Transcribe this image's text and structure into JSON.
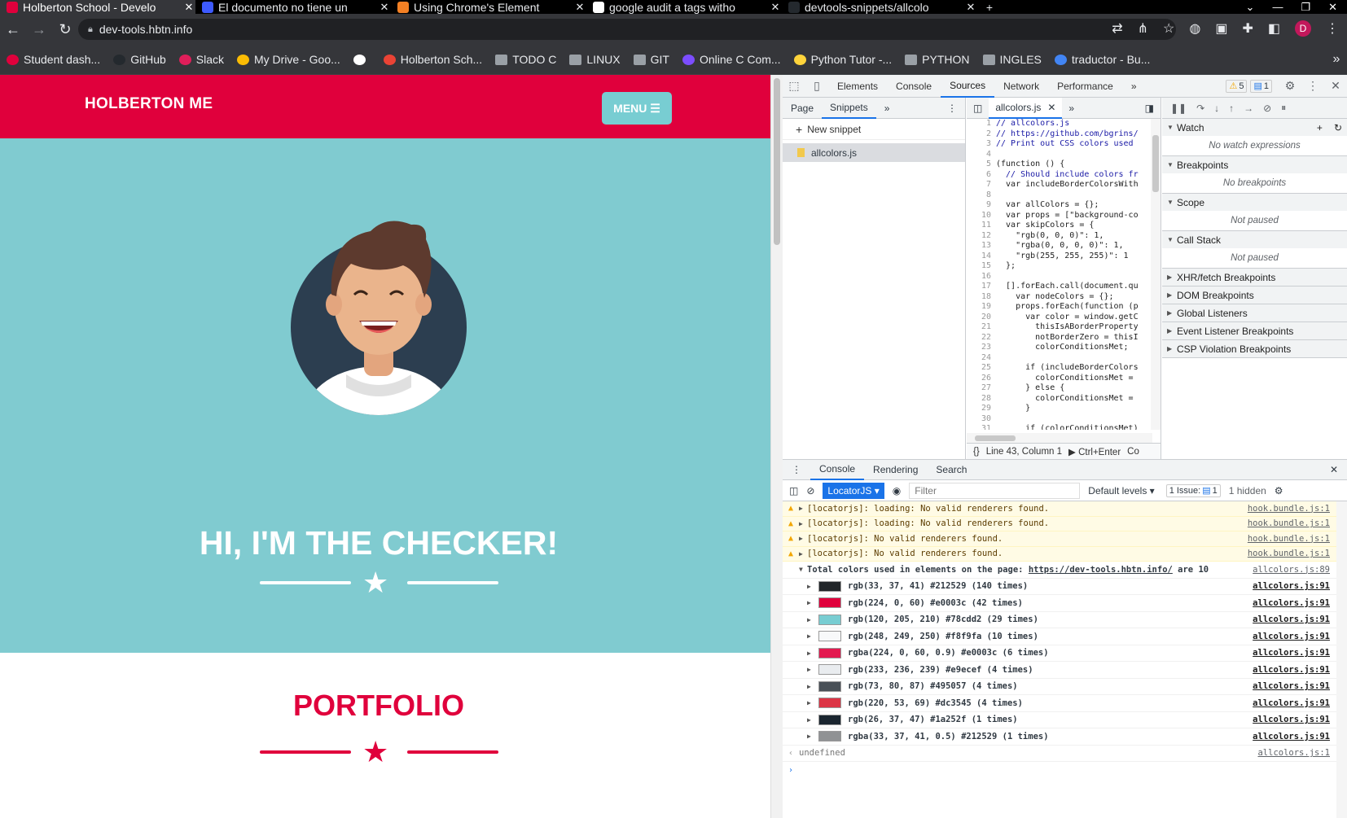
{
  "browser": {
    "tabs": [
      {
        "title": "Holberton School - Develo",
        "favicon_color": "#e0003c",
        "active": true
      },
      {
        "title": "El documento no tiene un",
        "favicon_color": "#3d5afe"
      },
      {
        "title": "Using Chrome's Element",
        "favicon_color": "#f48024"
      },
      {
        "title": "google audit a tags witho",
        "favicon_color": "#ffffff"
      },
      {
        "title": "devtools-snippets/allcolo",
        "favicon_color": "#24292e"
      }
    ],
    "tab_close": "✕",
    "new_tab": "+",
    "url": "dev-tools.hbtn.info",
    "profile_initial": "D",
    "bookmarks": [
      {
        "label": "Student dash...",
        "icon": "holberton-icon",
        "color": "#e0003c"
      },
      {
        "label": "GitHub",
        "icon": "github-icon",
        "color": "#24292e"
      },
      {
        "label": "Slack",
        "icon": "slack-icon",
        "color": "#e01e5a"
      },
      {
        "label": "My Drive - Goo...",
        "icon": "drive-icon",
        "color": "#fbbc04"
      },
      {
        "label": "",
        "icon": "globe-icon",
        "color": "#ffffff"
      },
      {
        "label": "Holberton Sch...",
        "icon": "gmail-icon",
        "color": "#ea4335"
      },
      {
        "label": "TODO C",
        "icon": "folder-icon",
        "color": "#9aa0a6"
      },
      {
        "label": "LINUX",
        "icon": "folder-icon",
        "color": "#9aa0a6"
      },
      {
        "label": "GIT",
        "icon": "folder-icon",
        "color": "#9aa0a6"
      },
      {
        "label": "Online C Com...",
        "icon": "compiler-icon",
        "color": "#7c4dff"
      },
      {
        "label": "Python Tutor -...",
        "icon": "python-icon",
        "color": "#ffd43b"
      },
      {
        "label": "PYTHON",
        "icon": "folder-icon",
        "color": "#9aa0a6"
      },
      {
        "label": "INGLES",
        "icon": "folder-icon",
        "color": "#9aa0a6"
      },
      {
        "label": "traductor - Bu...",
        "icon": "google-icon",
        "color": "#4285f4"
      }
    ],
    "more_bookmarks": "»"
  },
  "site": {
    "brand": "HOLBERTON ME",
    "menu_label": "MENU ☰",
    "hero_title": "HI, I'M THE CHECKER!",
    "portfolio_title": "PORTFOLIO",
    "colors": {
      "primary": "#e0003c",
      "secondary": "#78cdd2",
      "hero_bg": "#80cbd0"
    }
  },
  "devtools": {
    "tabs": [
      "Elements",
      "Console",
      "Sources",
      "Network",
      "Performance"
    ],
    "active_tab": "Sources",
    "more": "»",
    "warn_count": "5",
    "info_count": "1",
    "navigator_tabs": [
      "Page",
      "Snippets"
    ],
    "new_snippet": "New snippet",
    "snippet_file": "allcolors.js",
    "editor_file": "allcolors.js",
    "code_lines": [
      "// allcolors.js",
      "// https://github.com/bgrins/",
      "// Print out CSS colors used",
      "",
      "(function () {",
      "  // Should include colors fr",
      "  var includeBorderColorsWith",
      "",
      "  var allColors = {};",
      "  var props = [\"background-co",
      "  var skipColors = {",
      "    \"rgb(0, 0, 0)\": 1,",
      "    \"rgba(0, 0, 0, 0)\": 1,",
      "    \"rgb(255, 255, 255)\": 1",
      "  };",
      "",
      "  [].forEach.call(document.qu",
      "    var nodeColors = {};",
      "    props.forEach(function (p",
      "      var color = window.getC",
      "        thisIsABorderProperty",
      "        notBorderZero = thisI",
      "        colorConditionsMet;",
      "",
      "      if (includeBorderColors",
      "        colorConditionsMet =",
      "      } else {",
      "        colorConditionsMet =",
      "      }",
      "",
      "      if (colorConditionsMet)"
    ],
    "status_braces": "{}",
    "status_position": "Line 43, Column 1",
    "status_run": "▶ Ctrl+Enter",
    "status_tail": "Co",
    "side_sections": [
      {
        "title": "Watch",
        "open": true,
        "body": "No watch expressions"
      },
      {
        "title": "Breakpoints",
        "open": true,
        "body": "No breakpoints"
      },
      {
        "title": "Scope",
        "open": true,
        "body": "Not paused"
      },
      {
        "title": "Call Stack",
        "open": true,
        "body": "Not paused"
      },
      {
        "title": "XHR/fetch Breakpoints",
        "open": false
      },
      {
        "title": "DOM Breakpoints",
        "open": false
      },
      {
        "title": "Global Listeners",
        "open": false
      },
      {
        "title": "Event Listener Breakpoints",
        "open": false
      },
      {
        "title": "CSP Violation Breakpoints",
        "open": false
      }
    ],
    "drawer_tabs": [
      "Console",
      "Rendering",
      "Search"
    ],
    "context": "LocatorJS ▾",
    "filter_placeholder": "Filter",
    "levels": "Default levels ▾",
    "issues": "1 Issue:",
    "issues_count": "1",
    "hidden": "1 hidden",
    "console_warnings": [
      {
        "text": "[locatorjs]: loading: No valid renderers found.",
        "src": "hook.bundle.js:1"
      },
      {
        "text": "[locatorjs]: loading: No valid renderers found.",
        "src": "hook.bundle.js:1"
      },
      {
        "text": "[locatorjs]: No valid renderers found.",
        "src": "hook.bundle.js:1"
      },
      {
        "text": "[locatorjs]: No valid renderers found.",
        "src": "hook.bundle.js:1"
      }
    ],
    "total_line": {
      "prefix": "Total colors used in elements on the page: ",
      "link": "https://dev-tools.hbtn.info/",
      "suffix": " are 10",
      "src": "allcolors.js:89"
    },
    "color_rows": [
      {
        "text": "rgb(33, 37, 41) #212529 (140 times)",
        "swatch": "#212529",
        "src": "allcolors.js:91"
      },
      {
        "text": "rgb(224, 0, 60) #e0003c (42 times)",
        "swatch": "#e0003c",
        "src": "allcolors.js:91"
      },
      {
        "text": "rgb(120, 205, 210) #78cdd2 (29 times)",
        "swatch": "#78cdd2",
        "src": "allcolors.js:91"
      },
      {
        "text": "rgb(248, 249, 250) #f8f9fa (10 times)",
        "swatch": "#f8f9fa",
        "src": "allcolors.js:91"
      },
      {
        "text": "rgba(224, 0, 60, 0.9) #e0003c (6 times)",
        "swatch": "#e31a50",
        "src": "allcolors.js:91"
      },
      {
        "text": "rgb(233, 236, 239) #e9ecef (4 times)",
        "swatch": "#e9ecef",
        "src": "allcolors.js:91"
      },
      {
        "text": "rgb(73, 80, 87) #495057 (4 times)",
        "swatch": "#495057",
        "src": "allcolors.js:91"
      },
      {
        "text": "rgb(220, 53, 69) #dc3545 (4 times)",
        "swatch": "#dc3545",
        "src": "allcolors.js:91"
      },
      {
        "text": "rgb(26, 37, 47) #1a252f (1 times)",
        "swatch": "#1a252f",
        "src": "allcolors.js:91"
      },
      {
        "text": "rgba(33, 37, 41, 0.5) #212529 (1 times)",
        "swatch": "#909294",
        "src": "allcolors.js:91"
      }
    ],
    "return_value": "undefined",
    "return_src": "allcolors.js:1",
    "prompt": "›"
  }
}
